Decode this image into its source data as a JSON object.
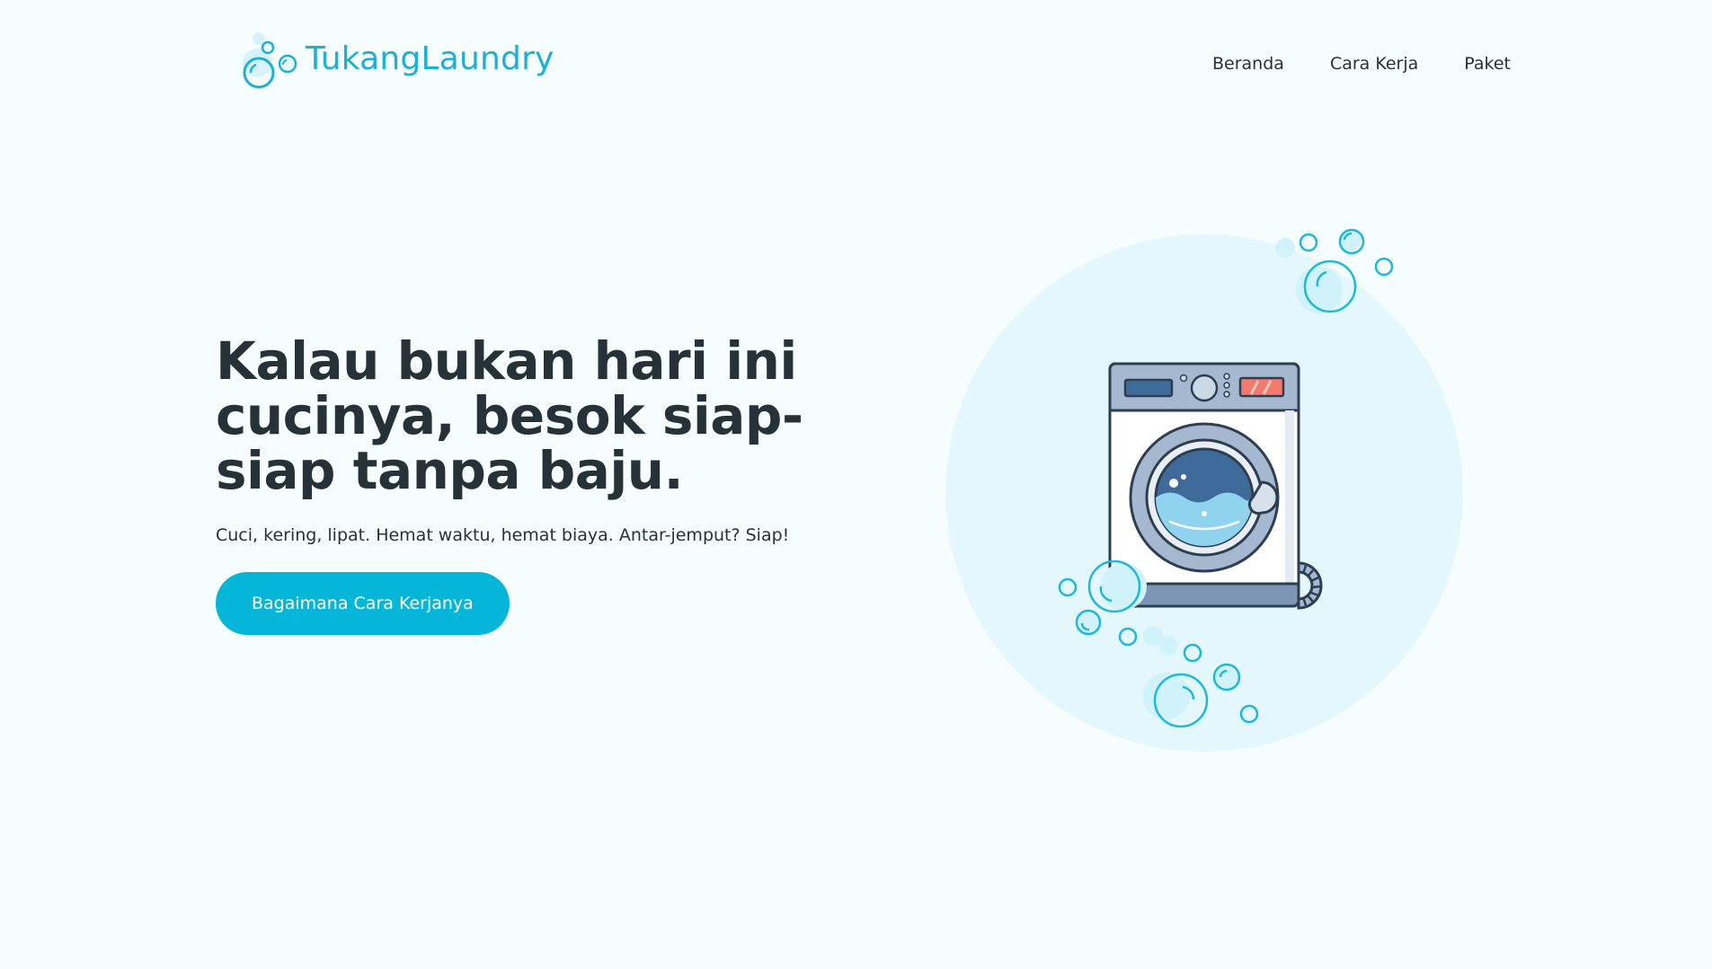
{
  "brand": {
    "name": "TukangLaundry",
    "color": "#1eb0d4"
  },
  "nav": {
    "items": [
      {
        "label": "Beranda"
      },
      {
        "label": "Cara Kerja"
      },
      {
        "label": "Paket"
      }
    ]
  },
  "hero": {
    "title": "Kalau bukan hari ini cucinya, besok siap-siap tanpa baju.",
    "subtitle": "Cuci, kering, lipat. Hemat waktu, hemat biaya. Antar-jemput? Siap!",
    "cta_label": "Bagaimana Cara Kerjanya",
    "cta_color": "#06b6d9"
  },
  "illustration": {
    "icon": "washing-machine-icon",
    "decor": "bubbles-icon"
  },
  "colors": {
    "background": "#f5fdff",
    "text": "#263238",
    "circle": "#e3f7fd"
  }
}
